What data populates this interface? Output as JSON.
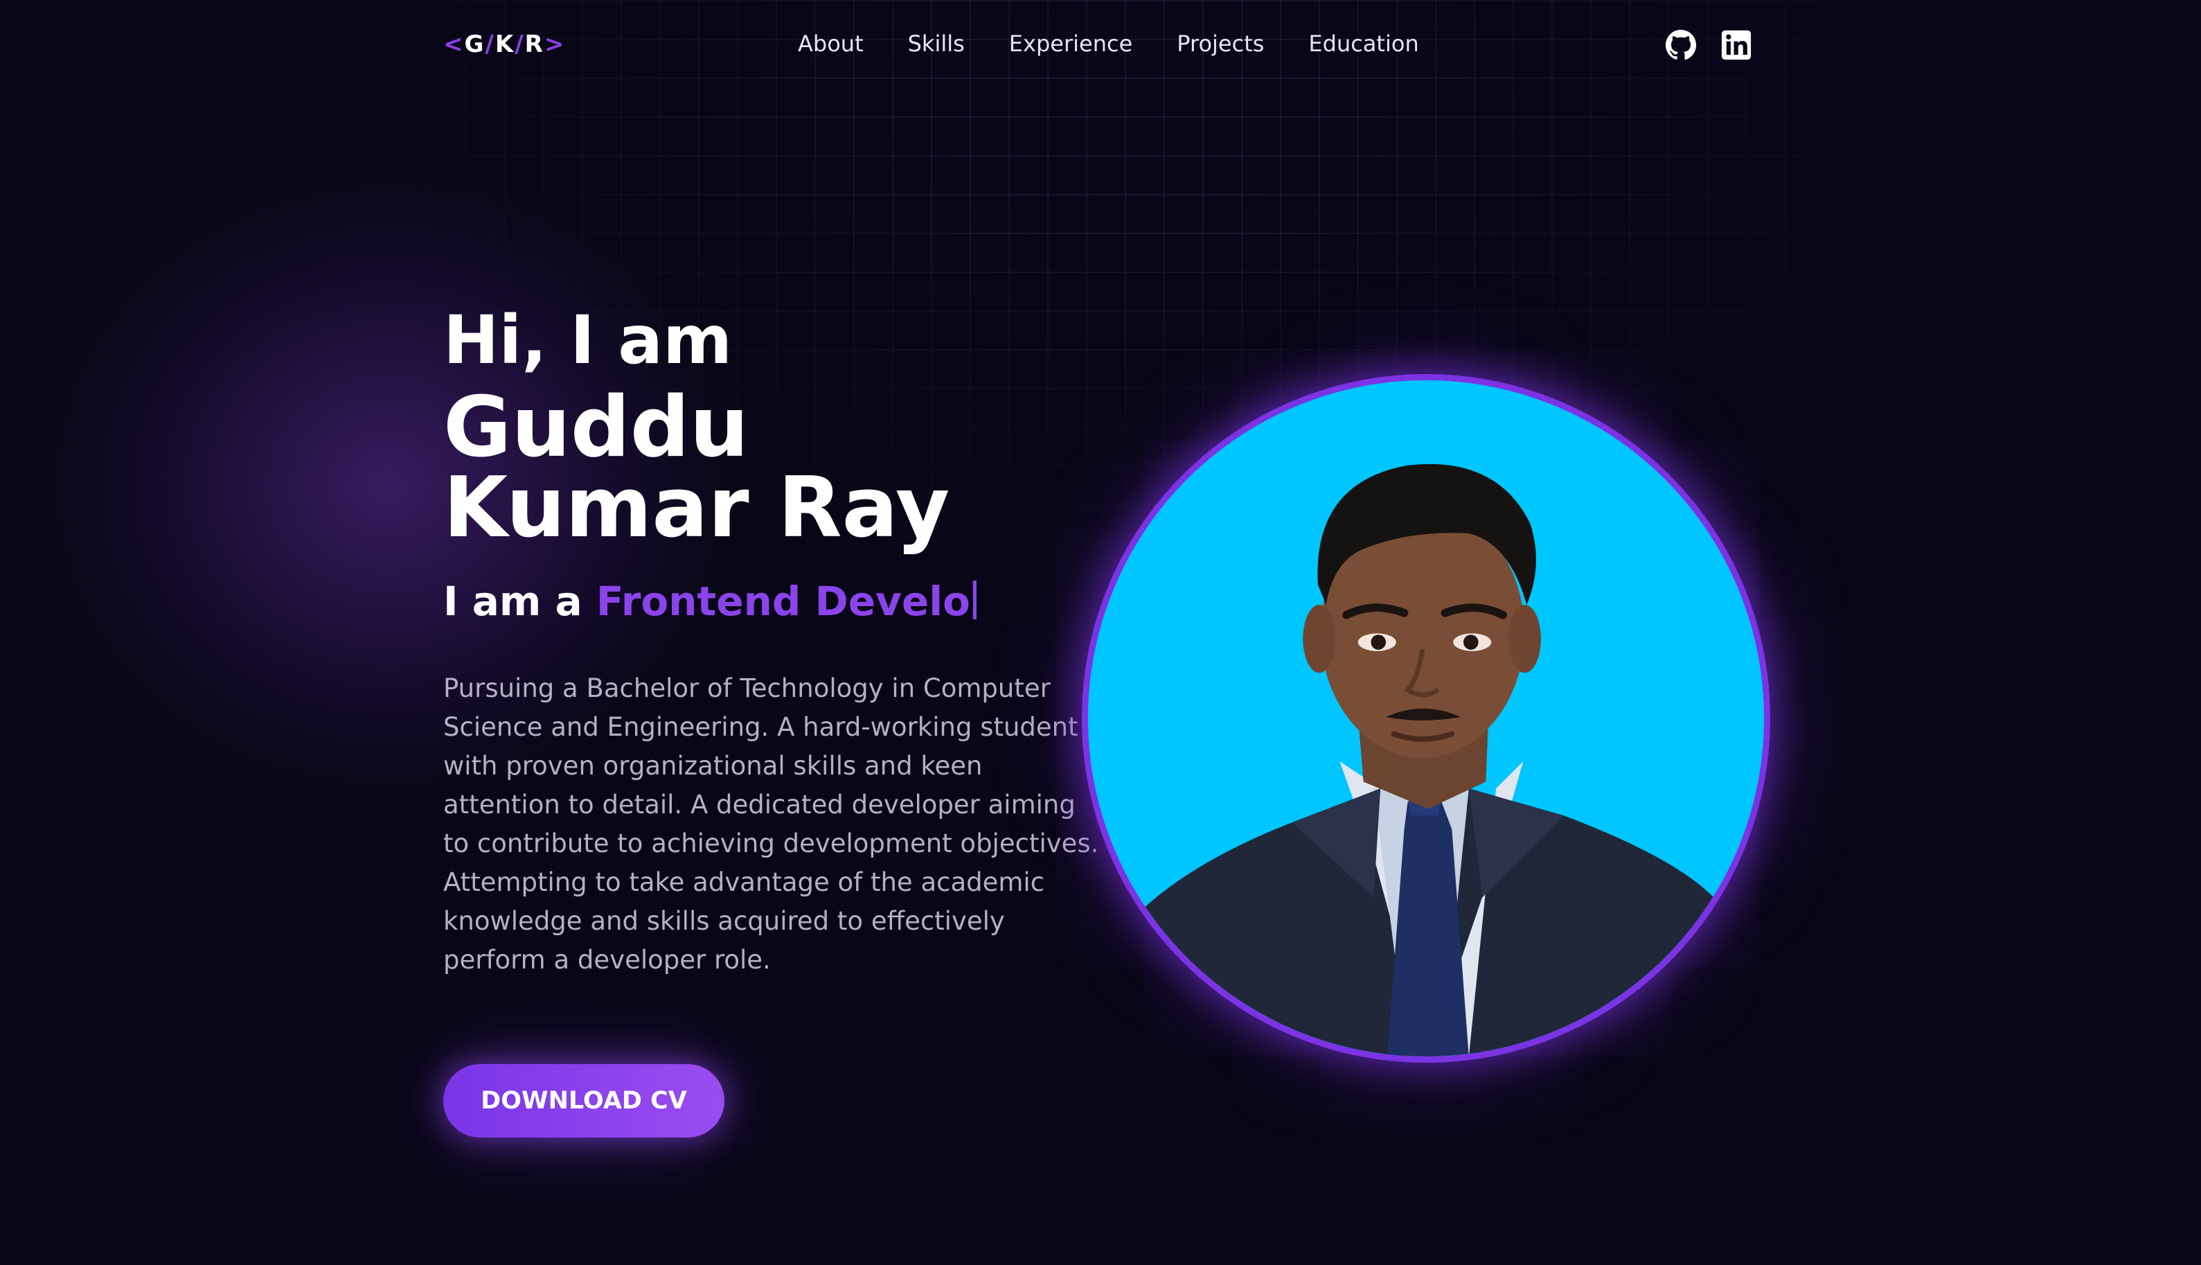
{
  "brand": {
    "logo_open": "<",
    "logo_g": "G",
    "logo_slash1": "/",
    "logo_k": "K",
    "logo_slash2": "/",
    "logo_r": "R",
    "logo_close": ">"
  },
  "nav": {
    "items": [
      {
        "label": "About"
      },
      {
        "label": "Skills"
      },
      {
        "label": "Experience"
      },
      {
        "label": "Projects"
      },
      {
        "label": "Education"
      }
    ]
  },
  "social": {
    "icons": [
      "github-icon",
      "linkedin-icon"
    ]
  },
  "hero": {
    "greeting": "Hi, I am",
    "name": "Guddu Kumar Ray",
    "role_prefix": "I am a ",
    "role_typed": "Frontend Develo",
    "description": "Pursuing a Bachelor of Technology in Computer Science and Engineering. A hard-working student with proven organizational skills and keen attention to detail. A dedicated developer aiming to contribute to achieving development objectives. Attempting to take advantage of the academic knowledge and skills acquired to effectively perform a developer role.",
    "cta_label": "DOWNLOAD CV"
  },
  "colors": {
    "background": "#090717",
    "accent": "#8a44ea",
    "portrait_bg": "#00c6ff",
    "text_muted": "#b4b1c2"
  }
}
